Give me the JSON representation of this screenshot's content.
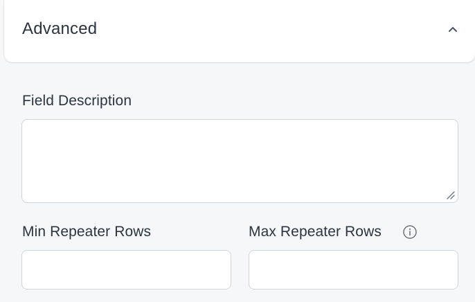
{
  "section": {
    "title": "Advanced",
    "collapse_icon": "chevron-up-icon"
  },
  "fields": {
    "description": {
      "label": "Field Description",
      "value": "",
      "placeholder": ""
    },
    "min_rows": {
      "label": "Min Repeater Rows",
      "value": "",
      "placeholder": ""
    },
    "max_rows": {
      "label": "Max Repeater Rows",
      "value": "",
      "placeholder": "",
      "help_icon": "info-icon"
    }
  }
}
